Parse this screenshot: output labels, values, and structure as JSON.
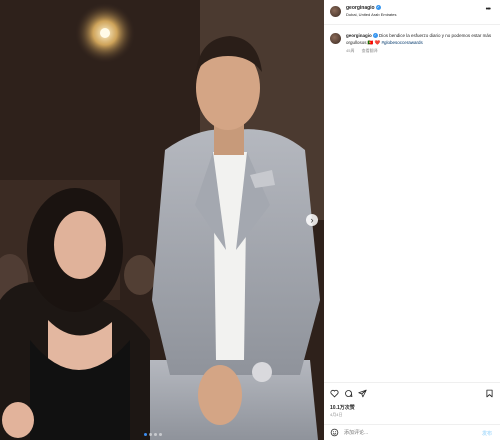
{
  "post": {
    "username": "georginagio",
    "location": "Dubai, United Arab Emirates",
    "more_icon": "more-horizontal-icon",
    "verified_icon": "verified-badge-icon"
  },
  "caption": {
    "username": "georginagio",
    "text": "Dios bendice la esfuerzo diario y no podemos estar más orgullosos 🇵🇹 ❤️",
    "hashtag": "#globesoccerawards",
    "time_ago": "45周",
    "translate_label": "查看翻译"
  },
  "actions": {
    "like_icon": "heart-icon",
    "comment_icon": "comment-icon",
    "share_icon": "send-icon",
    "save_icon": "bookmark-icon"
  },
  "likes_text": "10.1万次赞",
  "date_text": "4月4日",
  "comment": {
    "placeholder": "添加评论...",
    "emoji_icon": "smiley-icon",
    "post_label": "发布"
  },
  "carousel": {
    "slide_count": 4,
    "current_slide": 1,
    "next_icon": "chevron-right-icon"
  },
  "colors": {
    "verified": "#3897f0",
    "hashtag": "#00376b",
    "carousel_active": "#3b8cf0"
  }
}
